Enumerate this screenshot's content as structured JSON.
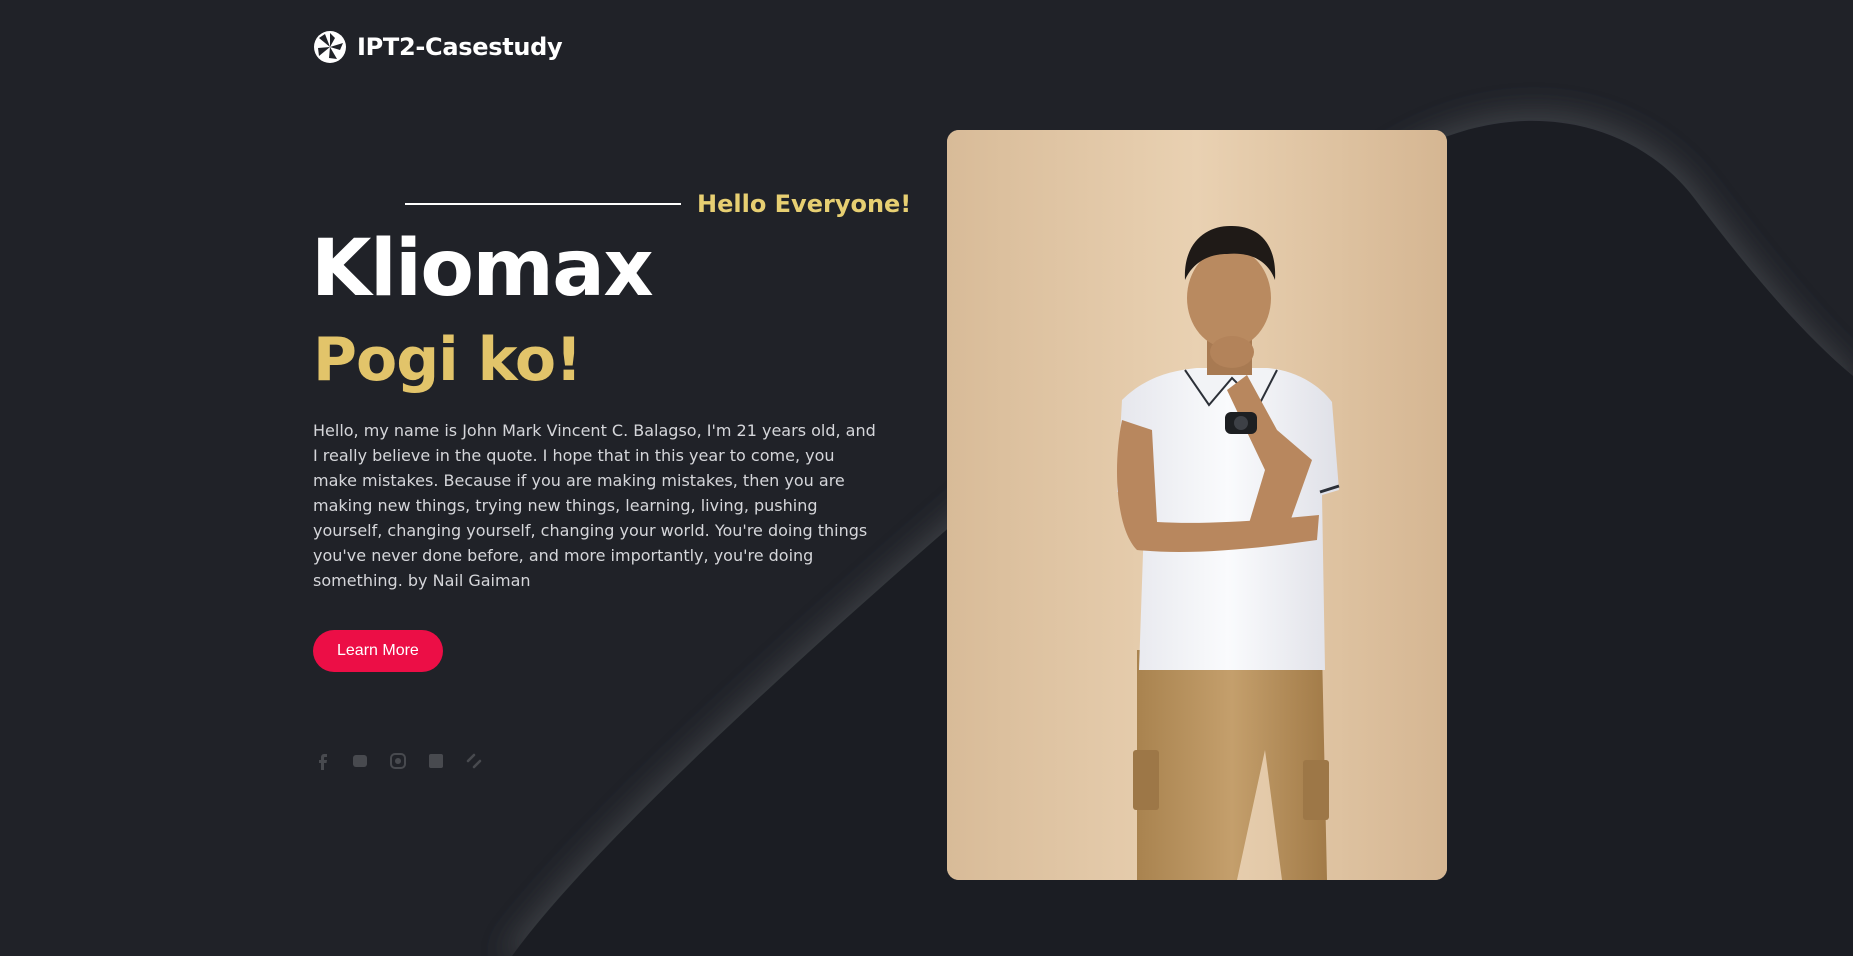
{
  "brand": {
    "name": "IPT2-Casestudy",
    "icon": "aperture-icon"
  },
  "hero": {
    "greeting": "Hello Everyone!",
    "name": "Kliomax",
    "tagline": "Pogi ko!",
    "bio": "Hello, my name is John Mark Vincent C. Balagso, I'm 21 years old, and I really believe in the quote. I hope that in this year to come, you make mistakes. Because if you are making mistakes, then you are making new things, trying new things, learning, living, pushing yourself, changing yourself, changing your world. You're doing things you've never done before, and more importantly, you're doing something. by Nail Gaiman",
    "cta_label": "Learn More"
  },
  "socials": [
    {
      "icon": "facebook-icon"
    },
    {
      "icon": "twitter-icon"
    },
    {
      "icon": "instagram-icon"
    },
    {
      "icon": "linkedin-icon"
    },
    {
      "icon": "link-icon"
    }
  ],
  "colors": {
    "background": "#202228",
    "accent_gold": "#e2c46a",
    "cta": "#ec0e46",
    "photo_backdrop": "#e2c7a5"
  }
}
